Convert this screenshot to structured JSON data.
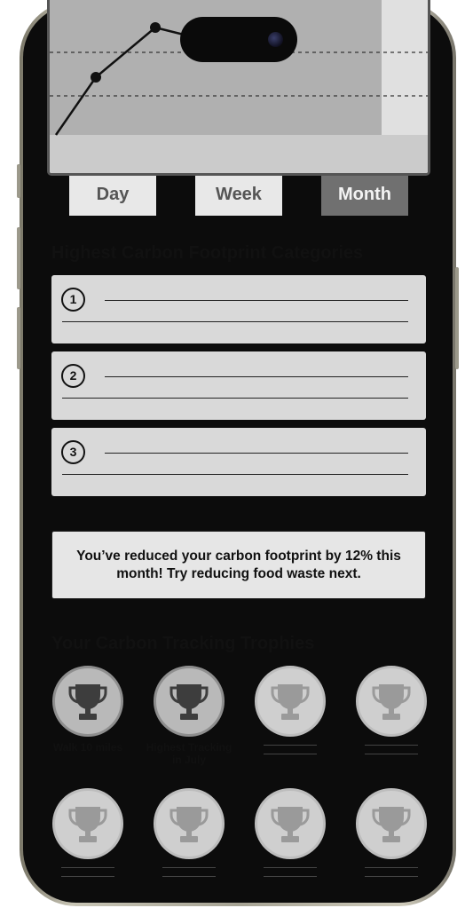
{
  "chart": {
    "grid_lines": "dashed",
    "line_color": "#111111"
  },
  "tabs": [
    {
      "label": "Day",
      "active": false
    },
    {
      "label": "Week",
      "active": false
    },
    {
      "label": "Month",
      "active": true
    }
  ],
  "categories_section": {
    "title": "Highest Carbon Footprint Categories",
    "items": [
      {
        "rank": "1"
      },
      {
        "rank": "2"
      },
      {
        "rank": "3"
      }
    ]
  },
  "insight": {
    "text": "You’ve reduced your carbon footprint by 12% this month! Try reducing food waste next."
  },
  "trophies_section": {
    "title": "Your Carbon Tracking Trophies",
    "trophies": [
      {
        "label": "Walk 10 miles",
        "earned": true
      },
      {
        "label": "Highest Tracking in July",
        "earned": true
      },
      {
        "label": "",
        "earned": false
      },
      {
        "label": "",
        "earned": false
      },
      {
        "label": "",
        "earned": false
      },
      {
        "label": "",
        "earned": false
      },
      {
        "label": "",
        "earned": false
      },
      {
        "label": "",
        "earned": false
      }
    ]
  },
  "colors": {
    "earned_trophy": "#3d3d3d",
    "locked_trophy": "#9a9a9a",
    "active_tab": "#707070"
  }
}
